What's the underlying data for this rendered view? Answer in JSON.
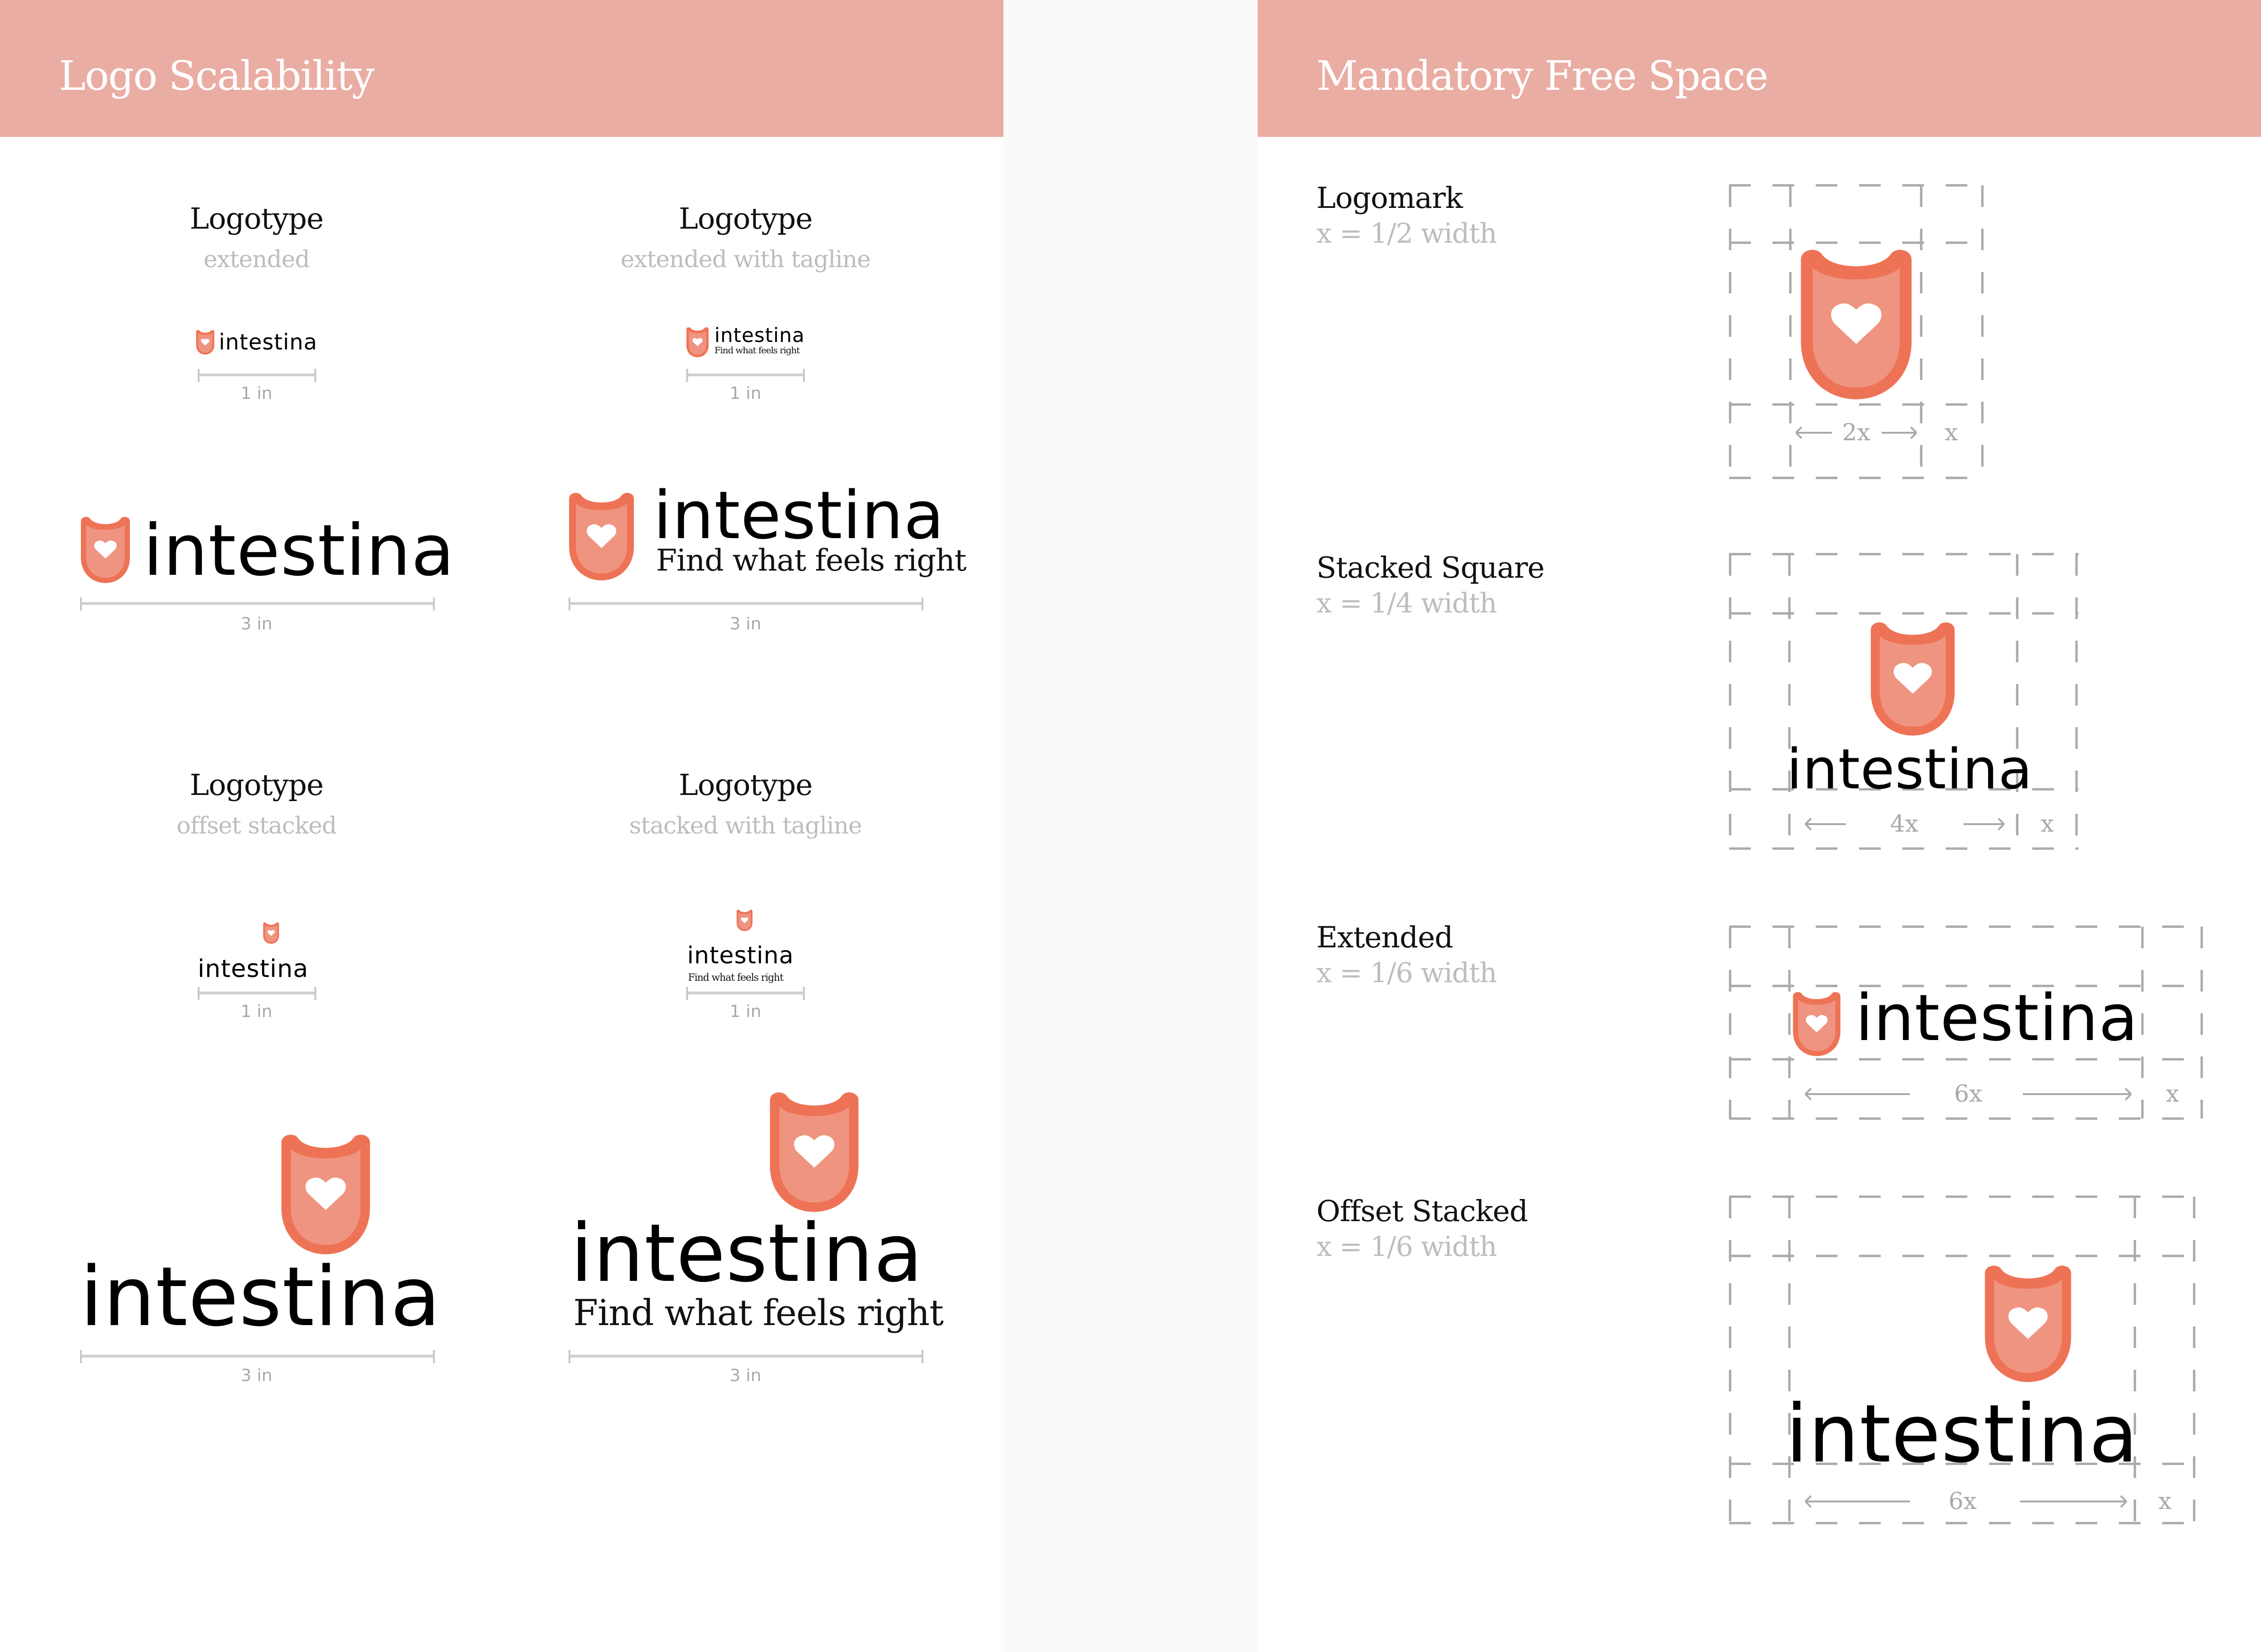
{
  "brand": {
    "name": "intestina",
    "tagline": "Find what feels right",
    "colors": {
      "header": "#EAADA3",
      "shield_stroke": "#EE7356",
      "shield_fill": "#EF9480",
      "heart": "#FFFFFF",
      "gridline": "#A9A9AD",
      "caption_muted": "#BDBDBD"
    }
  },
  "left": {
    "header_title": "Logo Scalability",
    "variants": [
      {
        "title": "Logotype",
        "subtitle": "extended",
        "small_size": "1 in",
        "large_size": "3 in"
      },
      {
        "title": "Logotype",
        "subtitle": "extended with tagline",
        "small_size": "1 in",
        "large_size": "3 in"
      },
      {
        "title": "Logotype",
        "subtitle": "offset stacked",
        "small_size": "1 in",
        "large_size": "3 in"
      },
      {
        "title": "Logotype",
        "subtitle": "stacked with tagline",
        "small_size": "1 in",
        "large_size": "3 in"
      }
    ]
  },
  "right": {
    "header_title": "Mandatory Free Space",
    "rules": [
      {
        "title": "Logomark",
        "rule": "x = 1/2 width",
        "span_label": "2x",
        "margin_label": "x"
      },
      {
        "title": "Stacked Square",
        "rule": "x = 1/4 width",
        "span_label": "4x",
        "margin_label": "x"
      },
      {
        "title": "Extended",
        "rule": "x = 1/6 width",
        "span_label": "6x",
        "margin_label": "x"
      },
      {
        "title": "Offset Stacked",
        "rule": "x = 1/6 width",
        "span_label": "6x",
        "margin_label": "x"
      }
    ]
  }
}
